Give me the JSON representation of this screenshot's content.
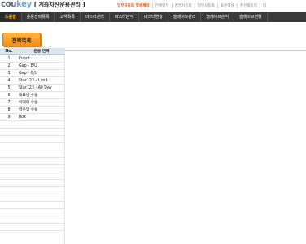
{
  "header": {
    "logo_part1": "cou",
    "logo_part2": "key",
    "app_title": "[ 계좌자산운용관리 ]",
    "links": [
      "업무자동화 맞춤제작",
      "전체업무",
      "경영자동화",
      "업무자동화",
      "표준엑셀",
      "추천웨이지",
      "업"
    ]
  },
  "nav": {
    "items": [
      "도움말",
      "운용전략목록",
      "고객목록",
      "마스터관리",
      "마스터손익",
      "마스터현황",
      "슬레이브관리",
      "슬레이브손익",
      "슬레이브현황"
    ]
  },
  "strategy_button": "전략목록",
  "table": {
    "headers": {
      "no": "No.",
      "name": "운용 전략"
    },
    "rows": [
      {
        "no": "1",
        "name": "Event"
      },
      {
        "no": "2",
        "name": "Gap - E/U"
      },
      {
        "no": "3",
        "name": "Gap - G/U"
      },
      {
        "no": "4",
        "name": "Star123 - Limit"
      },
      {
        "no": "5",
        "name": "Star123 - All Day"
      },
      {
        "no": "6",
        "name": "대표님 수동"
      },
      {
        "no": "7",
        "name": "이대리 수동"
      },
      {
        "no": "8",
        "name": "박주임 수동"
      },
      {
        "no": "9",
        "name": "Box"
      },
      {
        "no": "",
        "name": ""
      },
      {
        "no": "",
        "name": ""
      },
      {
        "no": "",
        "name": ""
      },
      {
        "no": "",
        "name": ""
      },
      {
        "no": "",
        "name": ""
      },
      {
        "no": "",
        "name": ""
      },
      {
        "no": "",
        "name": ""
      },
      {
        "no": "",
        "name": ""
      },
      {
        "no": "",
        "name": ""
      },
      {
        "no": "",
        "name": ""
      },
      {
        "no": "",
        "name": ""
      },
      {
        "no": "",
        "name": ""
      },
      {
        "no": "",
        "name": ""
      },
      {
        "no": "",
        "name": ""
      },
      {
        "no": "",
        "name": ""
      }
    ]
  },
  "colors": {
    "nav_bg": "#3a3a3a",
    "nav_active": "#f0b428",
    "button_orange": "#f49310",
    "header_blue": "#dce6f2",
    "logo_blue": "#6aa7d6"
  }
}
